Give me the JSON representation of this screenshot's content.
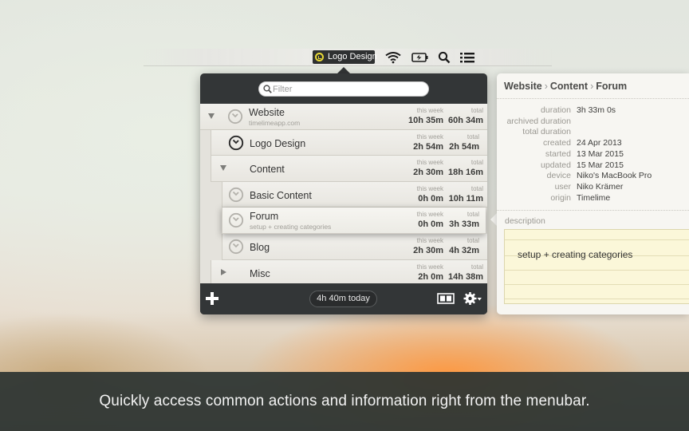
{
  "menubar": {
    "active_app": "Logo Design",
    "icons": [
      "wifi-icon",
      "battery-icon",
      "spotlight-search-icon",
      "menu-list-icon"
    ]
  },
  "search": {
    "placeholder": "Filter"
  },
  "tree": {
    "column_labels": {
      "week": "this week",
      "total": "total"
    },
    "rows": [
      {
        "title": "Website",
        "subtitle": "timelimeapp.com",
        "week": "10h 35m",
        "total": "60h 34m",
        "expanded": true,
        "has_clock": true
      },
      {
        "title": "Logo Design",
        "subtitle": "",
        "week": "2h 54m",
        "total": "2h 54m",
        "running": true,
        "has_clock": true
      },
      {
        "title": "Content",
        "subtitle": "",
        "week": "2h 30m",
        "total": "18h 16m",
        "expanded": true,
        "has_clock": false
      },
      {
        "title": "Basic Content",
        "subtitle": "",
        "week": "0h 0m",
        "total": "10h 11m",
        "has_clock": true
      },
      {
        "title": "Forum",
        "subtitle": "setup + creating categories",
        "week": "0h 0m",
        "total": "3h 33m",
        "selected": true,
        "has_clock": true
      },
      {
        "title": "Blog",
        "subtitle": "",
        "week": "2h 30m",
        "total": "4h 32m",
        "has_clock": true
      },
      {
        "title": "Misc",
        "subtitle": "",
        "week": "2h 0m",
        "total": "14h 38m",
        "expanded": false,
        "has_clock": false
      }
    ]
  },
  "footer": {
    "today": "4h 40m today"
  },
  "details": {
    "breadcrumb": [
      "Website",
      "Content",
      "Forum"
    ],
    "fields": [
      {
        "key": "duration",
        "value": "3h 33m 0s"
      },
      {
        "key": "archived duration",
        "value": ""
      },
      {
        "key": "total duration",
        "value": ""
      },
      {
        "key": "created",
        "value": "24 Apr 2013"
      },
      {
        "key": "started",
        "value": "13 Mar 2015"
      },
      {
        "key": "updated",
        "value": "15 Mar 2015"
      },
      {
        "key": "device",
        "value": "Niko's MacBook Pro"
      },
      {
        "key": "user",
        "value": "Niko Krämer"
      },
      {
        "key": "origin",
        "value": "Timelime"
      }
    ],
    "description_label": "description",
    "description": "setup + creating categories"
  },
  "caption": "Quickly access common actions and information right from the menubar.",
  "colors": {
    "menubar_active_bg": "#2e3031",
    "accent_yellow": "#e8d936",
    "popover_bg": "#333637",
    "note_bg": "#fbf7d9"
  }
}
